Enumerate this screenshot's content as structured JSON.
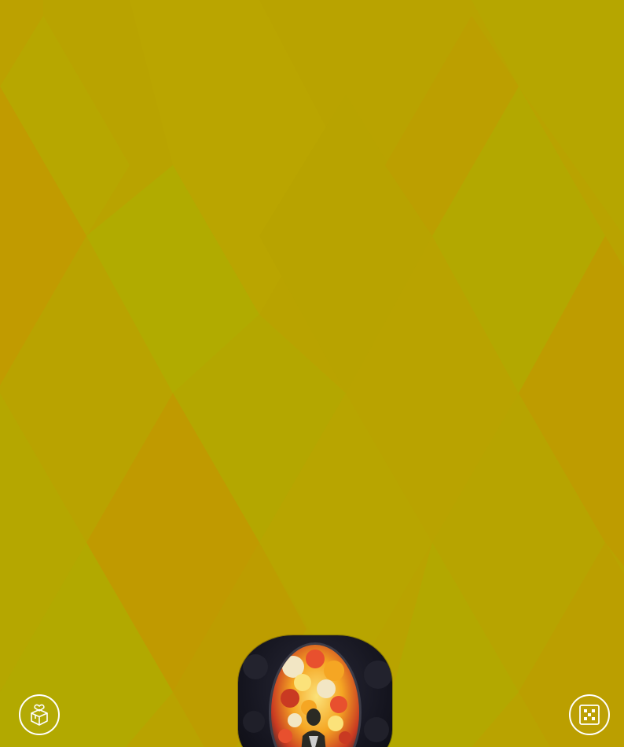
{
  "background": {
    "base_color": "#b9a300",
    "pattern": "diamond-harlequin",
    "shade_colors": [
      "#b3a600",
      "#bca100",
      "#c29a00",
      "#b0a900",
      "#bd9e00"
    ]
  },
  "card": {
    "name": "featured-artwork",
    "colors": {
      "frame": "#15151f",
      "flowers": [
        "#f2e6c4",
        "#e8502e",
        "#f5a623",
        "#fbe27a",
        "#c93a22"
      ],
      "figure": "#2b2a24"
    }
  },
  "buttons": {
    "left": {
      "icon": "gift-box-heart-icon"
    },
    "right": {
      "icon": "dice-grid-icon"
    }
  }
}
